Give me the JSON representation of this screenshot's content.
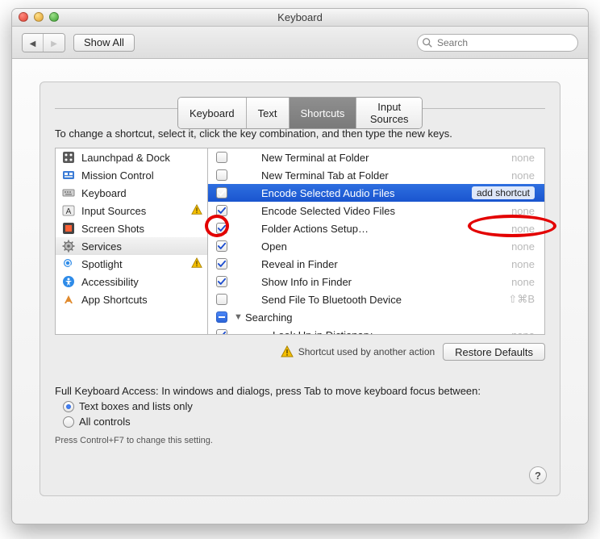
{
  "window": {
    "title": "Keyboard"
  },
  "toolbar": {
    "show_all_label": "Show All",
    "search_placeholder": "Search"
  },
  "tabs": {
    "items": [
      "Keyboard",
      "Text",
      "Shortcuts",
      "Input Sources"
    ],
    "active_index": 2
  },
  "instruction": "To change a shortcut, select it, click the key combination, and then type the new keys.",
  "sidebar": {
    "items": [
      {
        "label": "Launchpad & Dock",
        "icon": "launchpad-icon",
        "warning": false
      },
      {
        "label": "Mission Control",
        "icon": "mission-control-icon",
        "warning": false
      },
      {
        "label": "Keyboard",
        "icon": "keyboard-icon",
        "warning": false
      },
      {
        "label": "Input Sources",
        "icon": "input-sources-icon",
        "warning": true
      },
      {
        "label": "Screen Shots",
        "icon": "screenshots-icon",
        "warning": false
      },
      {
        "label": "Services",
        "icon": "services-gear-icon",
        "warning": false,
        "selected": true
      },
      {
        "label": "Spotlight",
        "icon": "spotlight-icon",
        "warning": true
      },
      {
        "label": "Accessibility",
        "icon": "accessibility-icon",
        "warning": false
      },
      {
        "label": "App Shortcuts",
        "icon": "app-shortcuts-icon",
        "warning": false
      }
    ]
  },
  "services_list": {
    "rows": [
      {
        "kind": "item",
        "checked": false,
        "label": "New Terminal at Folder",
        "shortcut": "none"
      },
      {
        "kind": "item",
        "checked": false,
        "label": "New Terminal Tab at Folder",
        "shortcut": "none"
      },
      {
        "kind": "item",
        "checked": true,
        "label": "Encode Selected Audio Files",
        "shortcut": "add shortcut",
        "selected": true,
        "action_button": true
      },
      {
        "kind": "item",
        "checked": true,
        "label": "Encode Selected Video Files",
        "shortcut": "none"
      },
      {
        "kind": "item",
        "checked": true,
        "label": "Folder Actions Setup…",
        "shortcut": "none"
      },
      {
        "kind": "item",
        "checked": true,
        "label": "Open",
        "shortcut": "none"
      },
      {
        "kind": "item",
        "checked": true,
        "label": "Reveal in Finder",
        "shortcut": "none"
      },
      {
        "kind": "item",
        "checked": true,
        "label": "Show Info in Finder",
        "shortcut": "none"
      },
      {
        "kind": "item",
        "checked": false,
        "label": "Send File To Bluetooth Device",
        "shortcut": "⇧⌘B"
      },
      {
        "kind": "group",
        "checked": "mixed",
        "label": "Searching"
      },
      {
        "kind": "item",
        "checked": true,
        "label": "Look Up in Dictionary",
        "shortcut": "none",
        "under_group": true
      }
    ]
  },
  "footer": {
    "warning_text": "Shortcut used by another action",
    "restore_defaults_label": "Restore Defaults"
  },
  "full_keyboard_access": {
    "heading": "Full Keyboard Access: In windows and dialogs, press Tab to move keyboard focus between:",
    "options": [
      {
        "label": "Text boxes and lists only",
        "selected": true
      },
      {
        "label": "All controls",
        "selected": false
      }
    ],
    "hint": "Press Control+F7 to change this setting."
  },
  "icons": {
    "check_color": "#1a4bcf",
    "check_color_sel": "#ffffff",
    "warning_color": "#f5bf00"
  }
}
